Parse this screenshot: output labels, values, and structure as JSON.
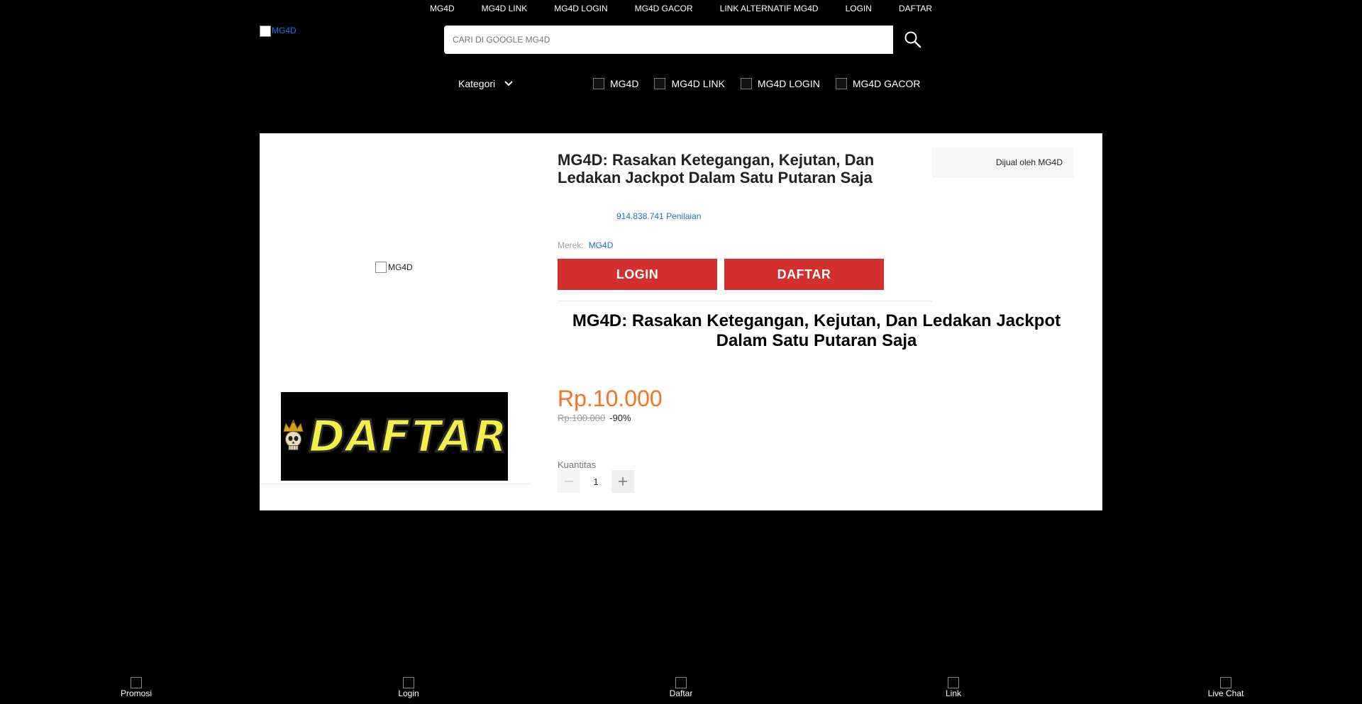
{
  "top_nav": [
    "MG4D",
    "MG4D LINK",
    "MG4D LOGIN",
    "MG4D GACOR",
    "LINK ALTERNATIF MG4D",
    "LOGIN",
    "DAFTAR"
  ],
  "logo_alt": "MG4D",
  "search": {
    "placeholder": "CARI DI GOOGLE MG4D",
    "icon": "search-icon"
  },
  "kategori": {
    "label": "Kategori",
    "icon": "chevron-down-icon"
  },
  "category_links": [
    "MG4D",
    "MG4D LINK",
    "MG4D LOGIN",
    "MG4D GACOR"
  ],
  "gallery": {
    "image_alt": "MG4D",
    "banner_text": "DAFTAR"
  },
  "product": {
    "title": "MG4D: Rasakan Ketegangan, Kejutan, Dan Ledakan Jackpot Dalam Satu Putaran Saja",
    "seller": "Dijual oleh MG4D",
    "ratings": "914.838.741 Penilaian",
    "brand_label": "Merek:",
    "brand_value": "MG4D",
    "login_button": "LOGIN",
    "daftar_button": "DAFTAR",
    "headline": "MG4D: Rasakan Ketegangan, Kejutan, Dan Ledakan Jackpot Dalam Satu Putaran Saja",
    "price": "Rp.10.000",
    "old_price": "Rp.100.000",
    "discount": "-90%",
    "quantity_label": "Kuantitas",
    "quantity_value": "1"
  },
  "bottom_bar": [
    "Promosi",
    "Login",
    "Daftar",
    "Link",
    "Live Chat"
  ],
  "colors": {
    "accent_red": "#d32f2f",
    "price_orange": "#f57224",
    "link_blue": "#1a73c8"
  }
}
